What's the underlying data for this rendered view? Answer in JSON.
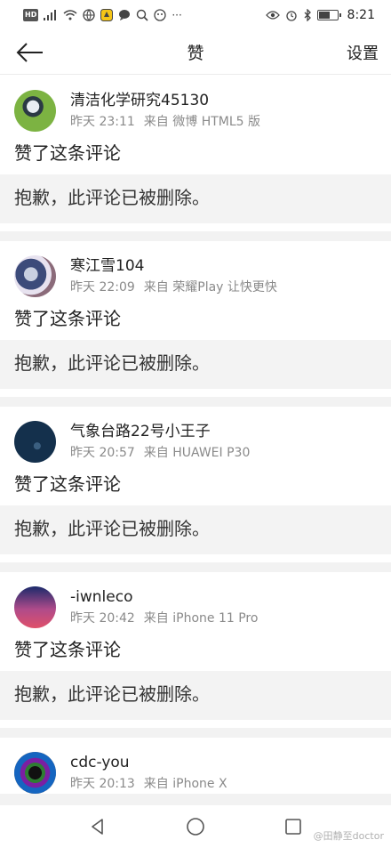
{
  "status_bar": {
    "hd_label": "HD",
    "signal": "4G",
    "more": "···",
    "time": "8:21",
    "battery_level": 0.55
  },
  "header": {
    "title": "赞",
    "settings_label": "设置"
  },
  "items": [
    {
      "username": "清洁化学研究45130",
      "time": "昨天 23:11",
      "source": "来自 微博 HTML5 版",
      "action": "赞了这条评论",
      "deleted_text": "抱歉，此评论已被删除。"
    },
    {
      "username": "寒江雪104",
      "time": "昨天 22:09",
      "source": "来自 荣耀Play 让快更快",
      "action": "赞了这条评论",
      "deleted_text": "抱歉，此评论已被删除。"
    },
    {
      "username": "气象台路22号小王子",
      "time": "昨天 20:57",
      "source": "来自 HUAWEI P30",
      "action": "赞了这条评论",
      "deleted_text": "抱歉，此评论已被删除。"
    },
    {
      "username": "-iwnleco",
      "time": "昨天 20:42",
      "source": "来自 iPhone 11 Pro",
      "action": "赞了这条评论",
      "deleted_text": "抱歉，此评论已被删除。"
    },
    {
      "username": "cdc-you",
      "time": "昨天 20:13",
      "source": "来自 iPhone X",
      "action": "",
      "deleted_text": ""
    }
  ],
  "watermark": "@田静至doctor",
  "icons": {
    "back": "back-arrow-icon",
    "nav_back": "triangle-back-icon",
    "nav_home": "circle-home-icon",
    "nav_recent": "square-recent-icon"
  }
}
